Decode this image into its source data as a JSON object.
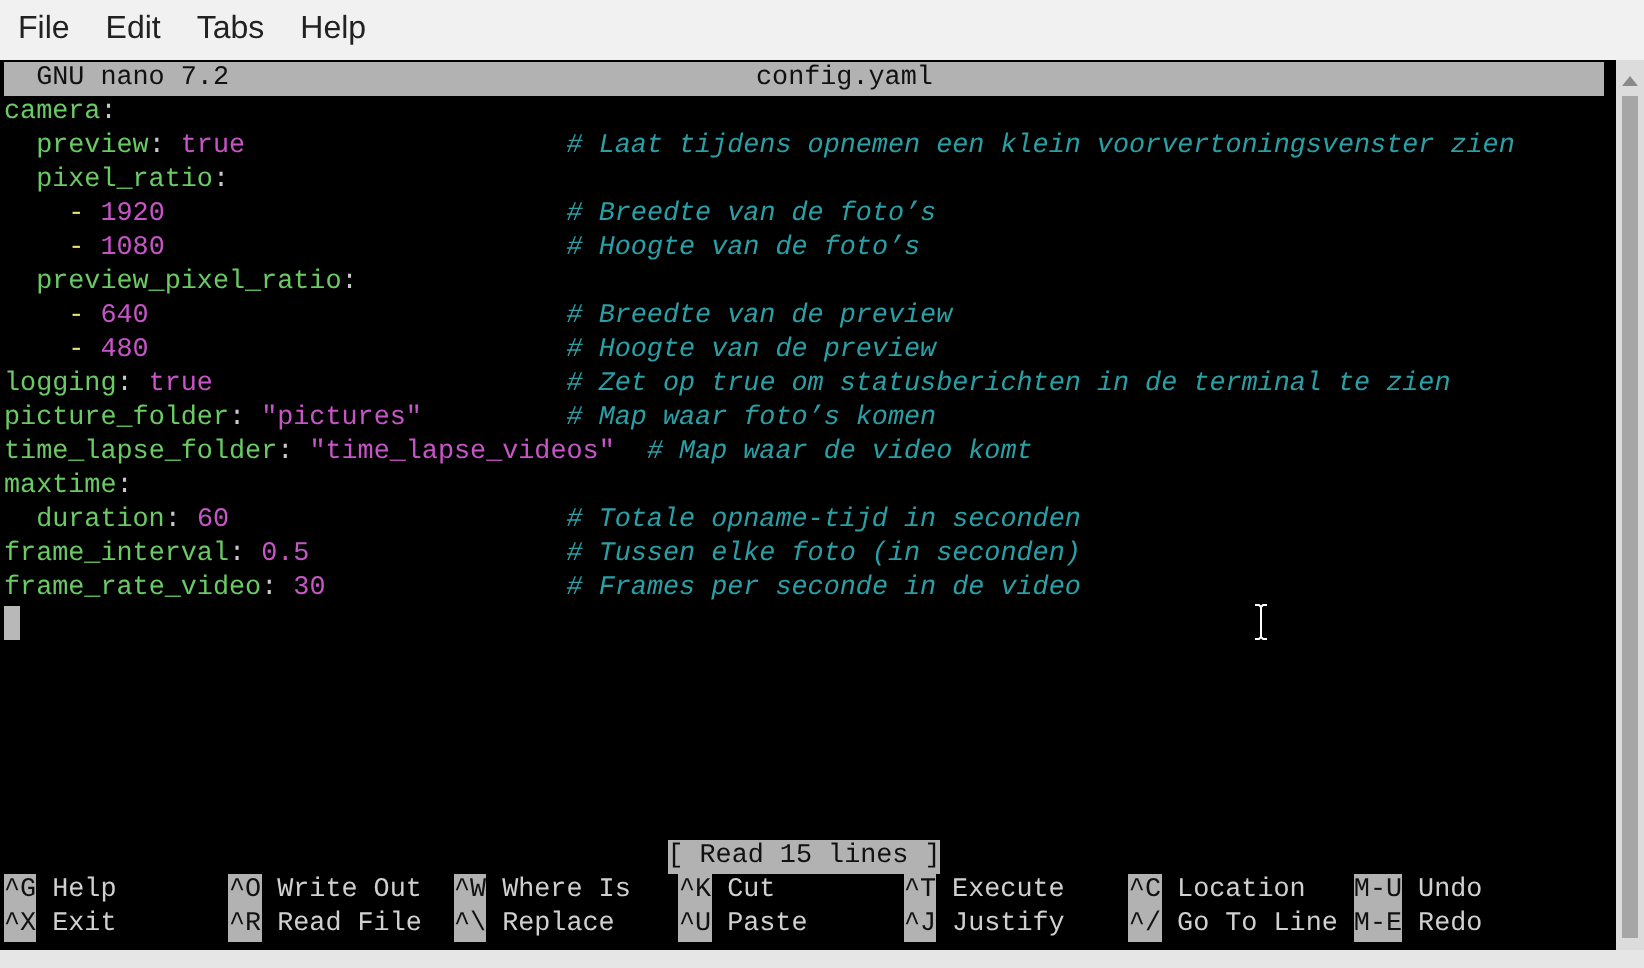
{
  "menu": [
    "File",
    "Edit",
    "Tabs",
    "Help"
  ],
  "title_bar": {
    "app": "GNU nano 7.2",
    "file": "config.yaml"
  },
  "lines": [
    {
      "key": "camera",
      "sep": ":",
      "children": [
        {
          "key": "preview",
          "sep": ":",
          "value": "true",
          "comment": "# Laat tijdens opnemen een klein voorvertoningsvenster zien"
        },
        {
          "key": "pixel_ratio",
          "sep": ":",
          "children": [
            {
              "marker": "-",
              "item": "1920",
              "comment": "# Breedte van de foto’s"
            },
            {
              "marker": "-",
              "item": "1080",
              "comment": "# Hoogte van de foto’s"
            }
          ]
        },
        {
          "key": "preview_pixel_ratio",
          "sep": ":",
          "children": [
            {
              "marker": "-",
              "item": "640",
              "comment": "# Breedte van de preview"
            },
            {
              "marker": "-",
              "item": "480",
              "comment": "# Hoogte van de preview"
            }
          ]
        }
      ]
    },
    {
      "key": "logging",
      "sep": ":",
      "value": "true",
      "comment": "# Zet op true om statusberichten in de terminal te zien"
    },
    {
      "key": "picture_folder",
      "sep": ":",
      "value": "\"pictures\"",
      "comment": "# Map waar foto’s komen"
    },
    {
      "key": "time_lapse_folder",
      "sep": ":",
      "value": "\"time_lapse_videos\"",
      "comment": "# Map waar de video komt"
    },
    {
      "key": "maxtime",
      "sep": ":",
      "children": [
        {
          "key": "duration",
          "sep": ":",
          "value": "60",
          "comment": "# Totale opname-tijd in seconden"
        }
      ]
    },
    {
      "key": "frame_interval",
      "sep": ":",
      "value": "0.5",
      "comment": "# Tussen elke foto (in seconden)"
    },
    {
      "key": "frame_rate_video",
      "sep": ":",
      "value": "30",
      "comment": "# Frames per seconde in de video"
    }
  ],
  "status": "[ Read 15 lines ]",
  "shortcuts": [
    [
      {
        "key": "^G",
        "label": "Help"
      },
      {
        "key": "^O",
        "label": "Write Out"
      },
      {
        "key": "^W",
        "label": "Where Is"
      },
      {
        "key": "^K",
        "label": "Cut"
      },
      {
        "key": "^T",
        "label": "Execute"
      },
      {
        "key": "^C",
        "label": "Location"
      },
      {
        "key": "M-U",
        "label": "Undo"
      }
    ],
    [
      {
        "key": "^X",
        "label": "Exit"
      },
      {
        "key": "^R",
        "label": "Read File"
      },
      {
        "key": "^\\",
        "label": "Replace"
      },
      {
        "key": "^U",
        "label": "Paste"
      },
      {
        "key": "^J",
        "label": "Justify"
      },
      {
        "key": "^/",
        "label": "Go To Line"
      },
      {
        "key": "M-E",
        "label": "Redo"
      }
    ]
  ]
}
